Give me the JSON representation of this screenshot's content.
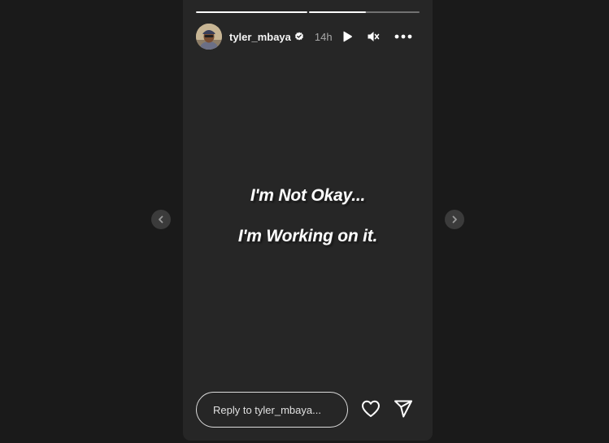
{
  "story": {
    "progress": [
      1.0,
      0.52
    ],
    "user": {
      "username": "tyler_mbaya",
      "verified": true,
      "time": "14h",
      "avatar_icon": "avatar-photo"
    },
    "controls": {
      "play_icon": "play-icon",
      "mute_icon": "muted-speaker-icon",
      "more_icon": "more-options-icon"
    },
    "caption": {
      "line1": "I'm Not Okay...",
      "line2": "I'm Working on it."
    },
    "footer": {
      "reply_placeholder": "Reply to tyler_mbaya...",
      "like_icon": "heart-icon",
      "share_icon": "send-icon"
    }
  },
  "navigation": {
    "prev_icon": "chevron-left-icon",
    "next_icon": "chevron-right-icon"
  },
  "colors": {
    "background": "#1a1a1a",
    "story_background": "#262626",
    "text": "#f5f5f5",
    "secondary_text": "#a8a8a8",
    "verified_badge": "#ffffff"
  }
}
